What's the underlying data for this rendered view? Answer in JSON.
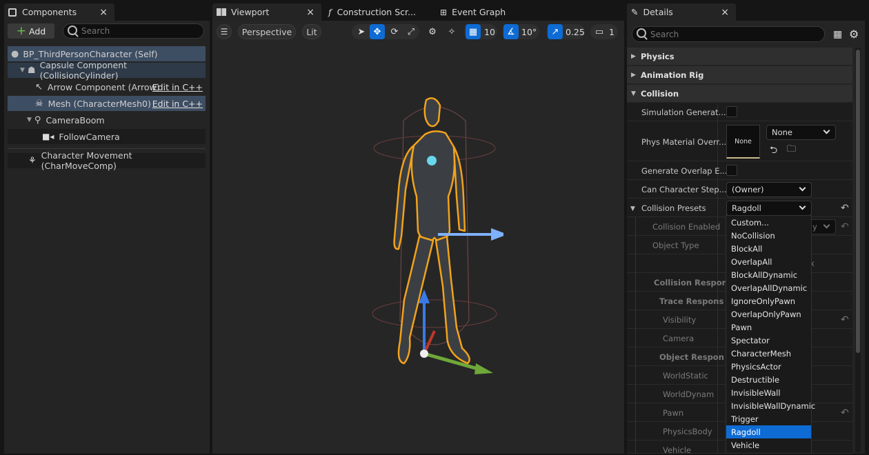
{
  "components_panel": {
    "tab_title": "Components",
    "add_label": "Add",
    "search_placeholder": "Search",
    "tree": [
      {
        "label": "BP_ThirdPersonCharacter (Self)"
      },
      {
        "label": "Capsule Component (CollisionCylinder)"
      },
      {
        "label": "Arrow Component (Arrow)",
        "action": "Edit in C++"
      },
      {
        "label": "Mesh (CharacterMesh0)",
        "action": "Edit in C++"
      },
      {
        "label": "CameraBoom"
      },
      {
        "label": "FollowCamera"
      },
      {
        "label": "Character Movement (CharMoveComp)"
      }
    ]
  },
  "editor_tabs": [
    {
      "label": "Viewport"
    },
    {
      "label": "Construction Scr..."
    },
    {
      "label": "Event Graph"
    }
  ],
  "viewport_toolbar": {
    "perspective": "Perspective",
    "lit": "Lit",
    "grid_snap": "10",
    "rotation_snap": "10°",
    "scale_snap": "0.25",
    "camera_speed": "1"
  },
  "details_panel": {
    "tab_title": "Details",
    "search_placeholder": "Search",
    "categories": {
      "physics": "Physics",
      "animation_rig": "Animation Rig",
      "collision": "Collision"
    },
    "properties": {
      "simulation_generates": "Simulation Generat...",
      "phys_material_override": "Phys Material Overr...",
      "phys_thumb": "None",
      "phys_value": "None",
      "generate_overlap": "Generate Overlap E...",
      "can_character_step": "Can Character Step...",
      "can_character_step_value": "(Owner)",
      "collision_presets": "Collision Presets",
      "collision_presets_value": "Ragdoll",
      "collision_enabled": "Collision Enabled",
      "collision_enabled_value_tail": "y",
      "object_type": "Object Type",
      "hidden_x": "x",
      "collision_responses": "Collision Respons",
      "trace_responses": "Trace Respons",
      "visibility": "Visibility",
      "camera": "Camera",
      "object_responses": "Object Respon",
      "world_static": "WorldStatic",
      "world_dynamic": "WorldDynam",
      "pawn": "Pawn",
      "physics_body": "PhysicsBody",
      "vehicle": "Vehicle"
    },
    "preset_options": [
      "Custom...",
      "NoCollision",
      "BlockAll",
      "OverlapAll",
      "BlockAllDynamic",
      "OverlapAllDynamic",
      "IgnoreOnlyPawn",
      "OverlapOnlyPawn",
      "Pawn",
      "Spectator",
      "CharacterMesh",
      "PhysicsActor",
      "Destructible",
      "InvisibleWall",
      "InvisibleWallDynamic",
      "Trigger",
      "Ragdoll",
      "Vehicle"
    ],
    "selected_preset": "Ragdoll"
  },
  "colors": {
    "accent": "#0e6bd4",
    "selection": "#3d4d62",
    "outline": "#f2a31b"
  }
}
